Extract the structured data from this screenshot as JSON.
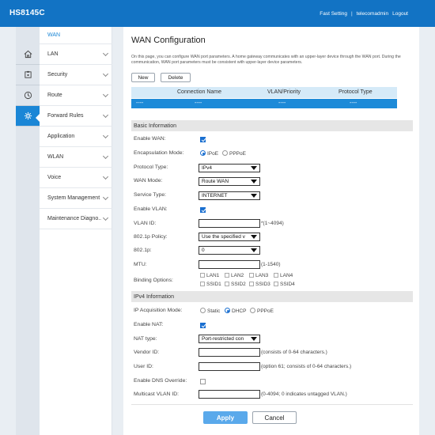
{
  "header": {
    "brand": "HS8145C",
    "links": [
      "Fast Setting",
      "telecomadmin",
      "Logout"
    ],
    "separator": "|"
  },
  "sidebar": {
    "icons": [
      "home-icon",
      "network-icon",
      "security-icon",
      "route-icon",
      "gear-icon"
    ],
    "sub_item": "WAN",
    "items": [
      {
        "label": "LAN"
      },
      {
        "label": "Security"
      },
      {
        "label": "Route"
      },
      {
        "label": "Forward Rules"
      },
      {
        "label": "Application"
      },
      {
        "label": "WLAN"
      },
      {
        "label": "Voice"
      },
      {
        "label": "System Management"
      },
      {
        "label": "Maintenance Diagno.."
      }
    ]
  },
  "main": {
    "title": "WAN Configuration",
    "description": "On this page, you can configure WAN port parameters. A home gateway communicates with an upper-layer device through the WAN port. During the communication, WAN port parameters must be consistent with upper-layer device parameters.",
    "buttons": {
      "new": "New",
      "delete": "Delete"
    },
    "table": {
      "columns": [
        "Connection Name",
        "VLAN/Priority",
        "Protocol Type"
      ],
      "row": [
        "----",
        "----",
        "----",
        "----"
      ]
    },
    "basic": {
      "section": "Basic Information",
      "enable_wan": {
        "label": "Enable WAN:",
        "checked": true
      },
      "encapsulation": {
        "label": "Encapsulation Mode:",
        "options": [
          "IPoE",
          "PPPoE"
        ],
        "selected": "IPoE"
      },
      "protocol_type": {
        "label": "Protocol Type:",
        "value": "IPv4"
      },
      "wan_mode": {
        "label": "WAN Mode:",
        "value": "Route WAN"
      },
      "service_type": {
        "label": "Service Type:",
        "value": "INTERNET"
      },
      "enable_vlan": {
        "label": "Enable VLAN:",
        "checked": true
      },
      "vlan_id": {
        "label": "VLAN ID:",
        "value": "",
        "hint": "*(1~4094)"
      },
      "policy": {
        "label": "802.1p Policy:",
        "value": "Use the specified v"
      },
      "p8021": {
        "label": "802.1p:",
        "value": "0"
      },
      "mtu": {
        "label": "MTU:",
        "value": "",
        "hint": "(1-1540)"
      },
      "binding": {
        "label": "Binding Options:",
        "row1": [
          "LAN1",
          "LAN2",
          "LAN3",
          "LAN4"
        ],
        "row2": [
          "SSID1",
          "SSID2",
          "SSID3",
          "SSID4"
        ]
      }
    },
    "ipv4": {
      "section": "IPv4 Information",
      "acquisition": {
        "label": "IP Acquisition Mode:",
        "options": [
          "Static",
          "DHCP",
          "PPPoE"
        ],
        "selected": "DHCP"
      },
      "enable_nat": {
        "label": "Enable NAT:",
        "checked": true
      },
      "nat_type": {
        "label": "NAT type:",
        "value": "Port-restricted con"
      },
      "vendor_id": {
        "label": "Vendor ID:",
        "value": "",
        "hint": "(consists of 0-64 characters.)"
      },
      "user_id": {
        "label": "User ID:",
        "value": "",
        "hint": "(option 61; consists of 0-64 characters.)"
      },
      "dns_override": {
        "label": "Enable DNS Override:",
        "checked": false
      },
      "multicast_vlan": {
        "label": "Multicast VLAN ID:",
        "value": "",
        "hint": "(0-4094; 0 indicates untagged VLAN.)"
      }
    },
    "actions": {
      "apply": "Apply",
      "cancel": "Cancel"
    }
  },
  "colors": {
    "header": "#1273c4",
    "accent": "#1a86d6",
    "table_row": "#1d8ad8",
    "apply": "#5aa9eb"
  }
}
